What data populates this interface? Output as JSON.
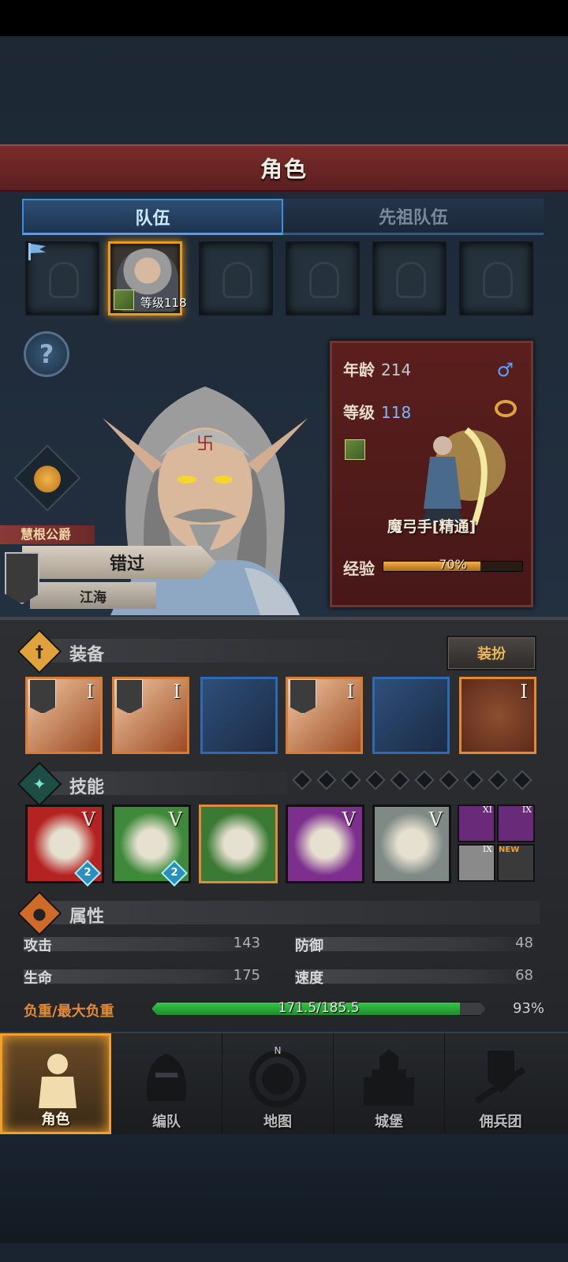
{
  "header": {
    "title": "角色"
  },
  "tabs": {
    "team": "队伍",
    "ancestor": "先祖队伍"
  },
  "party": {
    "active_level_text": "等级118"
  },
  "hero": {
    "title": "慧根公爵",
    "name": "错过",
    "location": "江海"
  },
  "stats": {
    "age_label": "年龄",
    "age": "214",
    "level_label": "等级",
    "level": "118",
    "class_name": "魔弓手[精通]",
    "exp_label": "经验",
    "exp_text": "70%",
    "exp_fraction": 0.7
  },
  "equipment": {
    "title": "装备",
    "dress_button": "装扮",
    "items": [
      {
        "name": "weapon-1",
        "tier": "I",
        "style": "orange"
      },
      {
        "name": "weapon-2",
        "tier": "I",
        "style": "orange"
      },
      {
        "name": "helmet",
        "tier": "",
        "style": "blue"
      },
      {
        "name": "armor",
        "tier": "I",
        "style": "orange"
      },
      {
        "name": "boots",
        "tier": "",
        "style": "blue"
      },
      {
        "name": "emblem",
        "tier": "I",
        "style": "red"
      }
    ]
  },
  "skills": {
    "title": "技能",
    "items": [
      {
        "tier": "V",
        "level": "2",
        "color": "#b52222"
      },
      {
        "tier": "V",
        "level": "2",
        "color": "#3f8a3a"
      },
      {
        "tier": "",
        "level": "",
        "color": "#3a7a34"
      },
      {
        "tier": "V",
        "level": "",
        "color": "#7d2f8e"
      },
      {
        "tier": "V",
        "level": "",
        "color": "#7f8a86"
      }
    ],
    "passives": [
      {
        "tier": "XI"
      },
      {
        "tier": "IX"
      },
      {
        "tier": "IX"
      },
      {
        "tier": ""
      }
    ],
    "new_badge": "NEW"
  },
  "attributes": {
    "title": "属性",
    "attack_label": "攻击",
    "attack": "143",
    "defense_label": "防御",
    "defense": "48",
    "hp_label": "生命",
    "hp": "175",
    "speed_label": "速度",
    "speed": "68",
    "load_label": "负重/最大负重",
    "load_text": "171.5/185.5",
    "load_pct": "93%",
    "load_fraction": 0.925
  },
  "nav": {
    "items": [
      "角色",
      "编队",
      "地图",
      "城堡",
      "佣兵团"
    ]
  }
}
